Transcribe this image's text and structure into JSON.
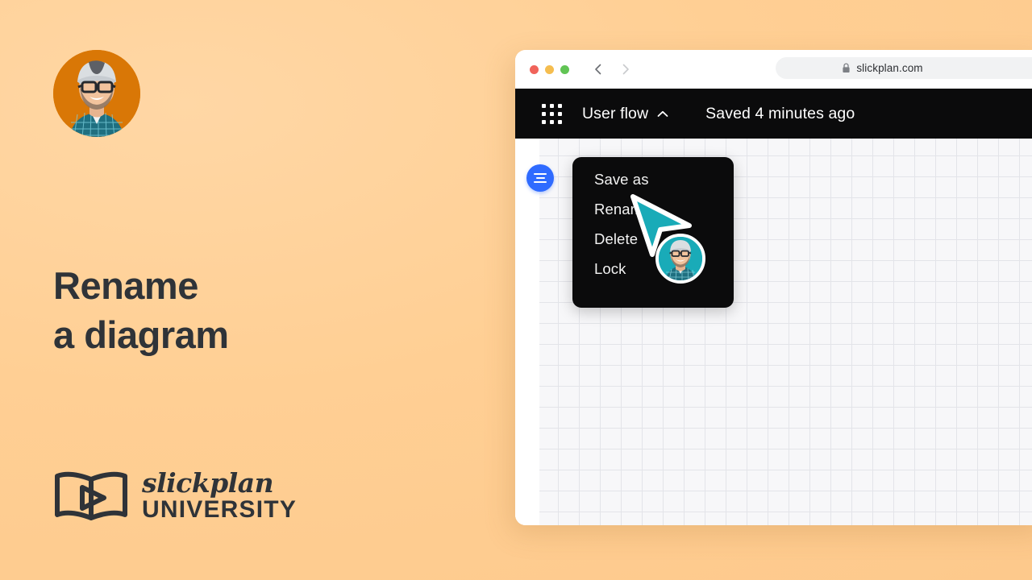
{
  "slide": {
    "background_color": "#ffcf94",
    "title_line1": "Rename",
    "title_line2": "a diagram",
    "presenter_avatar_alt": "presenter-avatar",
    "logo": {
      "icon": "open-book-play-icon",
      "script_word": "slickplan",
      "caps_word": "UNIVERSITY"
    }
  },
  "browser": {
    "traffic_lights": {
      "close_color": "#f0635a",
      "minimize_color": "#f5bd4f",
      "maximize_color": "#61c454"
    },
    "back_icon": "chevron-left-icon",
    "forward_icon": "chevron-right-icon",
    "address_bar": {
      "lock_icon": "padlock-icon",
      "url": "slickplan.com"
    }
  },
  "app": {
    "apps_grid_icon": "nine-dot-grid-icon",
    "document_title": "User flow",
    "title_caret_icon": "chevron-up-icon",
    "saved_status": "Saved 4 minutes ago",
    "topbar_color": "#0b0b0c"
  },
  "canvas": {
    "toolbar_button": {
      "icon": "menu-lines-icon",
      "color": "#2f6bff"
    },
    "context_menu": {
      "background_color": "#0b0b0c",
      "items": [
        {
          "label": "Save as"
        },
        {
          "label": "Rename"
        },
        {
          "label": "Delete"
        },
        {
          "label": "Lock"
        }
      ]
    },
    "cursor": {
      "icon": "pointer-arrow-cursor",
      "color": "#19abb8"
    },
    "collaborator_avatar": {
      "icon": "user-avatar",
      "ring_color": "#ffffff",
      "background_color": "#19abb8"
    }
  }
}
